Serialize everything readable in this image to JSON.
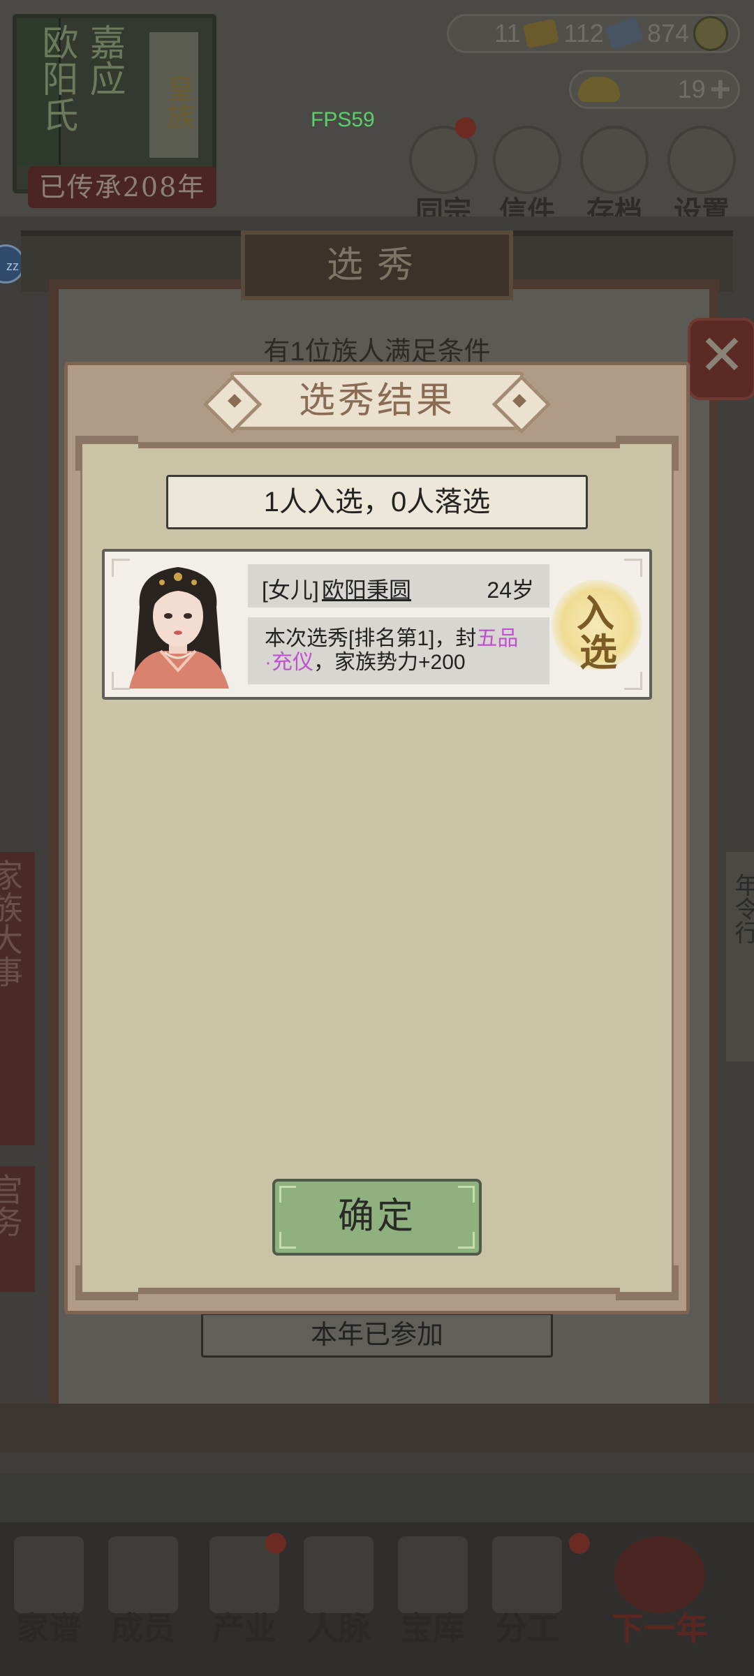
{
  "hud": {
    "fps": "FPS59",
    "family_book": {
      "line1": "嘉应",
      "line2": "欧阳氏",
      "tag": "皇族"
    },
    "generations": "已传承208年",
    "resources": {
      "gem": "11",
      "ticket": "112",
      "coin": "874",
      "ingot": "19"
    },
    "top_nav": [
      {
        "label": "同宗"
      },
      {
        "label": "信件"
      },
      {
        "label": "存档"
      },
      {
        "label": "设置"
      }
    ],
    "zz_badge": "zz"
  },
  "background_panel": {
    "title": "选秀",
    "subtitle": "有1位族人满足条件",
    "joined_label": "本年已参加",
    "side_left": "家族大事",
    "side_left2": "宫务",
    "side_right": "年令行"
  },
  "result_modal": {
    "title": "选秀结果",
    "summary": "1人入选，0人落选",
    "entry": {
      "relation": "[女儿]",
      "name": "欧阳秉圆",
      "age": "24岁",
      "desc_prefix": "本次选秀[排名第1]，封",
      "rank_title_part1": "五品",
      "rank_title_part2": "·充仪",
      "desc_suffix": "，家族势力+200",
      "stamp_line1": "入",
      "stamp_line2": "选"
    },
    "confirm_label": "确定"
  },
  "bottom_nav": [
    {
      "label": "家谱"
    },
    {
      "label": "成员"
    },
    {
      "label": "产业"
    },
    {
      "label": "人脉"
    },
    {
      "label": "宝库"
    },
    {
      "label": "分工"
    },
    {
      "label": "下一年"
    }
  ],
  "colors": {
    "accent_purple": "#c14fd1",
    "confirm_green": "#8fb07f",
    "modal_frame": "#b19b86",
    "fps_green": "#5bd06a"
  }
}
